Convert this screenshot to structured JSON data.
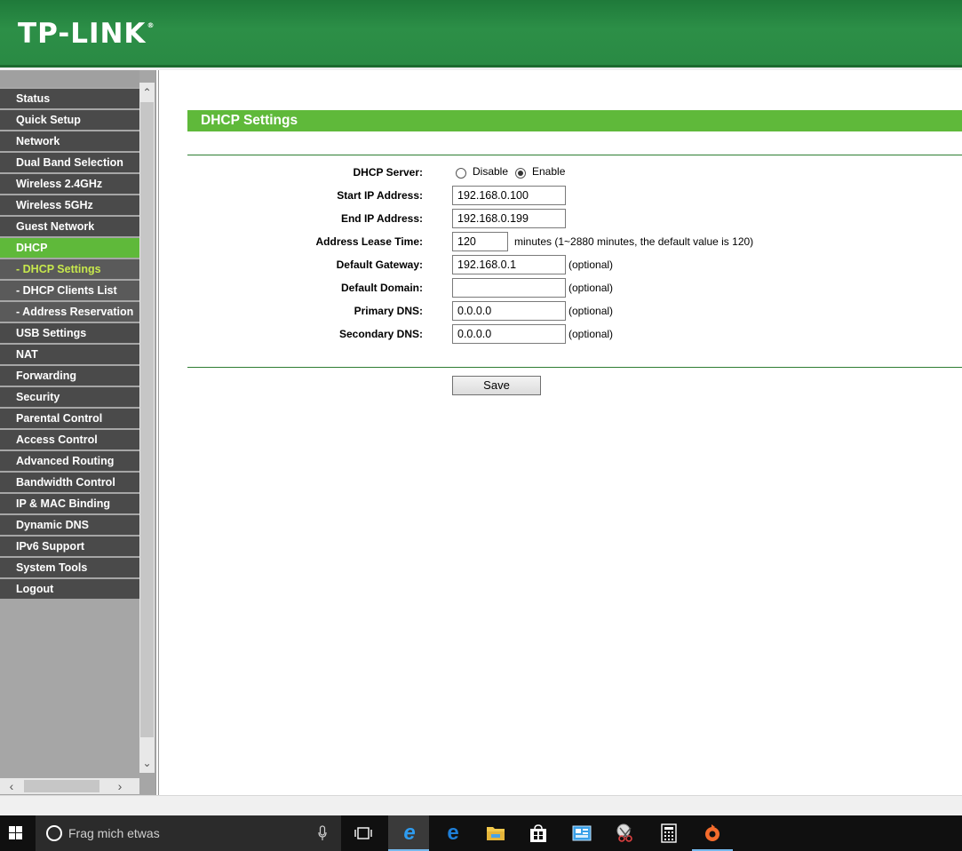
{
  "header": {
    "logo": "TP-LINK",
    "logo_mark": "®"
  },
  "sidebar": {
    "items": [
      {
        "label": "Status",
        "state": "normal"
      },
      {
        "label": "Quick Setup",
        "state": "normal"
      },
      {
        "label": "Network",
        "state": "normal"
      },
      {
        "label": "Dual Band Selection",
        "state": "normal"
      },
      {
        "label": "Wireless 2.4GHz",
        "state": "normal"
      },
      {
        "label": "Wireless 5GHz",
        "state": "normal"
      },
      {
        "label": "Guest Network",
        "state": "normal"
      },
      {
        "label": "DHCP",
        "state": "active"
      },
      {
        "label": "- DHCP Settings",
        "state": "sub-current"
      },
      {
        "label": "- DHCP Clients List",
        "state": "sub"
      },
      {
        "label": "- Address Reservation",
        "state": "sub"
      },
      {
        "label": "USB Settings",
        "state": "normal"
      },
      {
        "label": "NAT",
        "state": "normal"
      },
      {
        "label": "Forwarding",
        "state": "normal"
      },
      {
        "label": "Security",
        "state": "normal"
      },
      {
        "label": "Parental Control",
        "state": "normal"
      },
      {
        "label": "Access Control",
        "state": "normal"
      },
      {
        "label": "Advanced Routing",
        "state": "normal"
      },
      {
        "label": "Bandwidth Control",
        "state": "normal"
      },
      {
        "label": "IP & MAC Binding",
        "state": "normal"
      },
      {
        "label": "Dynamic DNS",
        "state": "normal"
      },
      {
        "label": "IPv6 Support",
        "state": "normal"
      },
      {
        "label": "System Tools",
        "state": "normal"
      },
      {
        "label": "Logout",
        "state": "normal"
      }
    ]
  },
  "main": {
    "title": "DHCP Settings",
    "dhcp_server": {
      "label": "DHCP Server:",
      "disable_label": "Disable",
      "enable_label": "Enable",
      "selected": "Enable"
    },
    "start_ip": {
      "label": "Start IP Address:",
      "value": "192.168.0.100"
    },
    "end_ip": {
      "label": "End IP Address:",
      "value": "192.168.0.199"
    },
    "lease_time": {
      "label": "Address Lease Time:",
      "value": "120",
      "note": "minutes (1~2880 minutes, the default value is 120)"
    },
    "gateway": {
      "label": "Default Gateway:",
      "value": "192.168.0.1",
      "note": "(optional)"
    },
    "domain": {
      "label": "Default Domain:",
      "value": "",
      "note": "(optional)"
    },
    "primary_dns": {
      "label": "Primary DNS:",
      "value": "0.0.0.0",
      "note": "(optional)"
    },
    "secondary_dns": {
      "label": "Secondary DNS:",
      "value": "0.0.0.0",
      "note": "(optional)"
    },
    "save_label": "Save"
  },
  "taskbar": {
    "search_placeholder": "Frag mich etwas",
    "apps": [
      "task-view",
      "internet-explorer",
      "edge",
      "file-explorer",
      "store",
      "control-panel",
      "snipping-tool",
      "calculator",
      "origin"
    ]
  },
  "colors": {
    "header_green": "#2c8f47",
    "accent_green": "#5fb93a",
    "menu_dark": "#4a4a4a",
    "submenu_current": "#c7e84c"
  }
}
